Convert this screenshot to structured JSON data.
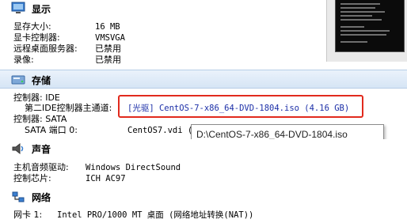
{
  "display": {
    "title": "显示",
    "video_memory_label": "显存大小:",
    "video_memory_value": "16 MB",
    "graphics_controller_label": "显卡控制器:",
    "graphics_controller_value": "VMSVGA",
    "remote_desktop_label": "远程桌面服务器:",
    "remote_desktop_value": "已禁用",
    "recording_label": "录像:",
    "recording_value": "已禁用"
  },
  "storage": {
    "title": "存储",
    "controller_ide_label": "控制器: IDE",
    "ide_secondary_master_label": "第二IDE控制器主通道:",
    "optical_drive_value": "[光驱] CentOS-7-x86_64-DVD-1804.iso (4.16 GB)",
    "controller_sata_label": "控制器: SATA",
    "sata_port_label": "SATA 端口 0:",
    "sata_port_value": "CentOS7.vdi (",
    "tooltip_path": "D:\\CentOS-7-x86_64-DVD-1804.iso"
  },
  "audio": {
    "title": "声音",
    "host_driver_label": "主机音频驱动:",
    "host_driver_value": "Windows DirectSound",
    "controller_label": "控制芯片:",
    "controller_value": "ICH AC97"
  },
  "network": {
    "title": "网络",
    "adapter1_label": "网卡 1:",
    "adapter1_value": "Intel PRO/1000 MT 桌面 (网络地址转换(NAT))"
  },
  "colors": {
    "header_blue": "#d6e5f5",
    "link_blue": "#1c2fa8",
    "highlight_red": "#e12a1d"
  }
}
